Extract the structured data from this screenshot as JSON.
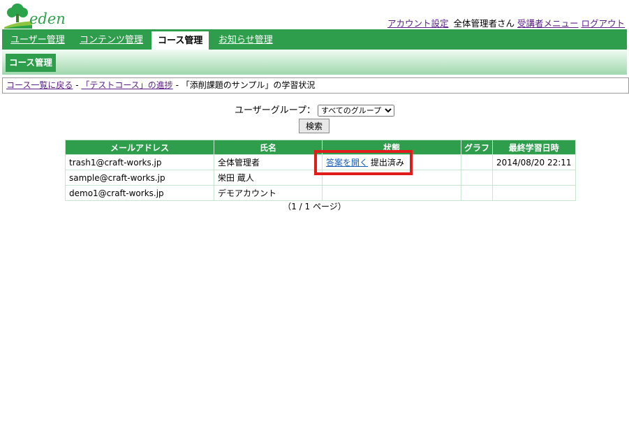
{
  "app": {
    "logo_text": "eden"
  },
  "header": {
    "account_settings": "アカウント設定",
    "user_name": "全体管理者さん",
    "student_menu": "受講者メニュー",
    "logout": "ログアウト"
  },
  "nav": {
    "tabs": [
      {
        "label": "ユーザー管理"
      },
      {
        "label": "コンテンツ管理"
      },
      {
        "label": "コース管理"
      },
      {
        "label": "お知らせ管理"
      }
    ],
    "active_tab": "コース管理",
    "sub_label": "コース管理"
  },
  "breadcrumb": {
    "back": "コース一覧に戻る",
    "sep1": " - ",
    "course_progress": "「テストコース」の進捗",
    "sep2": " - ",
    "current": "「添削課題のサンプル」の学習状況"
  },
  "filter": {
    "label": "ユーザーグループ：",
    "group_selected": "すべてのグループ",
    "search_button": "検索"
  },
  "table": {
    "headers": [
      "メールアドレス",
      "氏名",
      "状態",
      "グラフ",
      "最終学習日時"
    ],
    "rows": [
      {
        "email": "trash1@craft-works.jp",
        "name": "全体管理者",
        "answer_link": "答案を開く",
        "status": "提出済み",
        "graph": "",
        "last_study": "2014/08/20 22:11"
      },
      {
        "email": "sample@craft-works.jp",
        "name": "栄田 蔵人",
        "answer_link": "",
        "status": "",
        "graph": "",
        "last_study": ""
      },
      {
        "email": "demo1@craft-works.jp",
        "name": "デモアカウント",
        "answer_link": "",
        "status": "",
        "graph": "",
        "last_study": ""
      }
    ]
  },
  "pager": {
    "text": "（1 / 1 ページ）"
  },
  "colors": {
    "brand_green": "#2e9e4c",
    "highlight_red": "#e21b1b",
    "link_purple": "#5b1d86",
    "link_blue": "#1a5fb4"
  }
}
